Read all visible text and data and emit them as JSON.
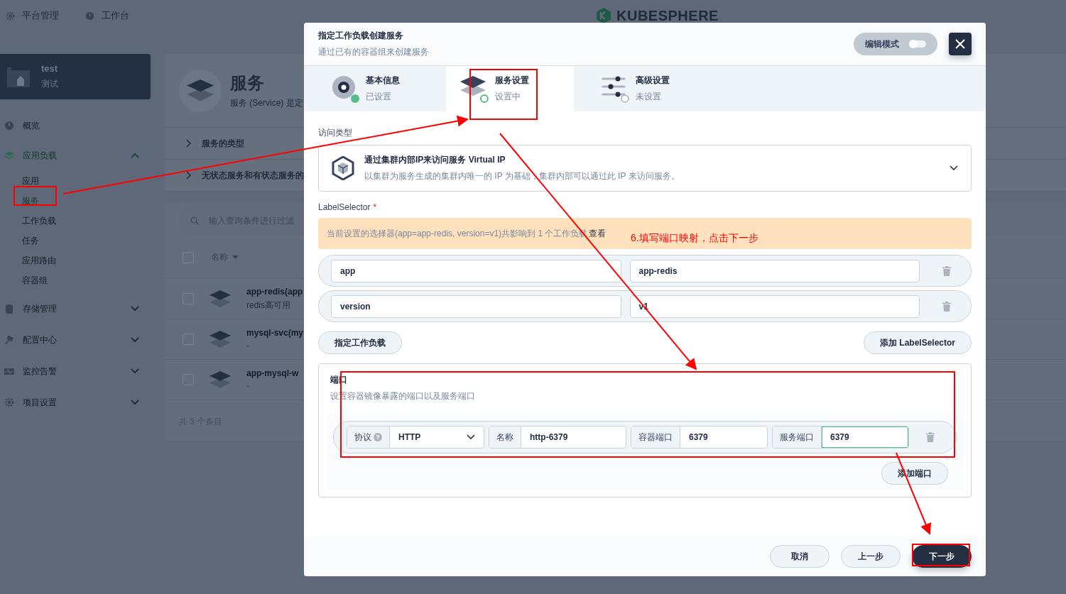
{
  "topbar": {
    "items": [
      {
        "label": "平台管理"
      },
      {
        "label": "工作台"
      }
    ],
    "logo": "KUBESPHERE"
  },
  "project": {
    "name": "test",
    "alias": "测试"
  },
  "nav": [
    {
      "kind": "link",
      "label": "概览"
    },
    {
      "kind": "group",
      "label": "应用负载",
      "expanded": true,
      "children": [
        {
          "label": "应用",
          "selected": false
        },
        {
          "label": "服务",
          "selected": true
        },
        {
          "label": "工作负载",
          "selected": false
        },
        {
          "label": "任务",
          "selected": false
        },
        {
          "label": "应用路由",
          "selected": false
        },
        {
          "label": "容器组",
          "selected": false
        }
      ]
    },
    {
      "kind": "group",
      "label": "存储管理",
      "expanded": false
    },
    {
      "kind": "group",
      "label": "配置中心",
      "expanded": false
    },
    {
      "kind": "group",
      "label": "监控告警",
      "expanded": false
    },
    {
      "kind": "group",
      "label": "项目设置",
      "expanded": false
    }
  ],
  "page": {
    "title": "服务",
    "description": "服务 (Service) 是定",
    "sections": [
      {
        "label": "服务的类型",
        "expanded": false
      },
      {
        "label": "无状态服务和有状态服务的",
        "expanded": false
      }
    ],
    "list": {
      "search_placeholder": "输入查询条件进行过滤",
      "column": "名称",
      "all_checked": false,
      "rows": [
        {
          "name": "app-redis(app",
          "description": "redis高可用",
          "checked": false
        },
        {
          "name": "mysql-svc(my",
          "description": "-",
          "checked": false
        },
        {
          "name": "app-mysql-w",
          "description": "-",
          "checked": false
        }
      ],
      "footer": "共 3 个条目"
    }
  },
  "modal": {
    "title": "指定工作负载创建服务",
    "subtitle": "通过已有的容器组来创建服务",
    "edit_mode": {
      "label": "编辑模式",
      "on": false
    },
    "steps": [
      {
        "title": "基本信息",
        "status_text": "已设置",
        "done": true,
        "selected": false
      },
      {
        "title": "服务设置",
        "status_text": "设置中",
        "done": false,
        "selected": true
      },
      {
        "title": "高级设置",
        "status_text": "未设置",
        "done": false,
        "selected": false
      }
    ],
    "access_type": {
      "label": "访问类型",
      "title": "通过集群内部IP来访问服务 Virtual IP",
      "description": "以集群为服务生成的集群内唯一的 IP 为基础，集群内部可以通过此 IP 来访问服务。"
    },
    "label_selector": {
      "label": "LabelSelector",
      "required_mark": "*",
      "notice": "当前设置的选择器(app=app-redis, version=v1)共影响到 1 个工作负载",
      "notice_link": "查看",
      "labels": [
        {
          "key": "app",
          "value": "app-redis"
        },
        {
          "key": "version",
          "value": "v1"
        }
      ],
      "buttons": [
        "指定工作负载",
        "添加 LabelSelector"
      ]
    },
    "ports": {
      "title": "端口",
      "description": "设置容器镜像暴露的端口以及服务端口",
      "rows": [
        {
          "protocol_label": "协议",
          "help_mark": "?",
          "protocol": "HTTP",
          "name_label": "名称",
          "name": "http-6379",
          "container_port_label": "容器端口",
          "container_port": "6379",
          "service_port_label": "服务端口",
          "service_port": "6379",
          "service_port_focused": true
        }
      ],
      "add_button": "添加端口"
    },
    "footer_buttons": [
      {
        "label": "取消",
        "kind": "secondary"
      },
      {
        "label": "上一步",
        "kind": "secondary"
      },
      {
        "label": "下一步",
        "kind": "primary"
      }
    ]
  },
  "annotation": "6.填写端口映射，点击下一步"
}
